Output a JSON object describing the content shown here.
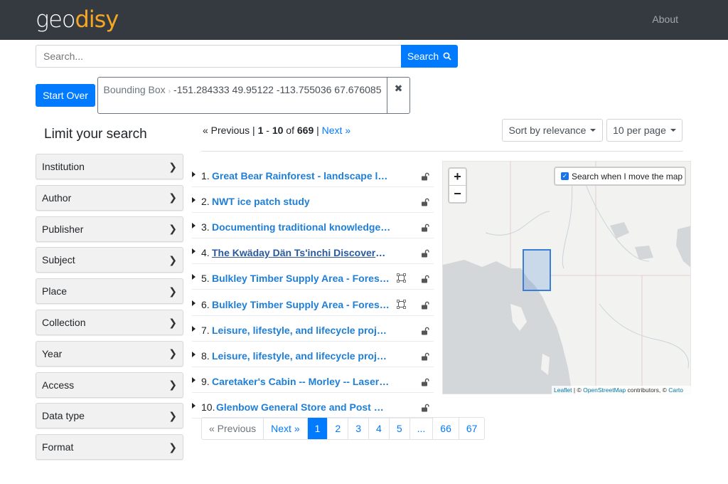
{
  "nav": {
    "logo_geo": "geo",
    "logo_disy": "disy",
    "about": "About"
  },
  "search": {
    "placeholder": "Search...",
    "button": "Search",
    "icon": "search-icon"
  },
  "constraints": {
    "start_over": "Start Over",
    "filter_name": "Bounding Box",
    "separator": "›",
    "filter_value": "-151.284333 49.95122 -113.755036 67.676085",
    "remove": "✖"
  },
  "sidebar": {
    "title": "Limit your search",
    "facets": [
      "Institution",
      "Author",
      "Publisher",
      "Subject",
      "Place",
      "Collection",
      "Year",
      "Access",
      "Data type",
      "Format"
    ]
  },
  "paging": {
    "previous": "« Previous",
    "separator": "|",
    "start": "1",
    "dash": "-",
    "end": "10",
    "of": "of",
    "total": "669",
    "next": "Next »"
  },
  "sort": {
    "sort_label": "Sort by relevance",
    "per_page_label": "10 per page"
  },
  "results": [
    {
      "num": "1.",
      "title": "Great Bear Rainforest - landscape level...",
      "bbox_icon": false,
      "underline": false
    },
    {
      "num": "2.",
      "title": "NWT ice patch study",
      "bbox_icon": false,
      "underline": false
    },
    {
      "num": "3.",
      "title": "Documenting traditional knowledge in ...",
      "bbox_icon": false,
      "underline": false
    },
    {
      "num": "4.",
      "title": "The Kwäday Dän Ts'inchi Discovery: Ex...",
      "bbox_icon": false,
      "underline": true
    },
    {
      "num": "5.",
      "title": "Bulkley Timber Supply Area - Forest Pl...",
      "bbox_icon": true,
      "underline": false
    },
    {
      "num": "6.",
      "title": "Bulkley Timber Supply Area - Forest Pl...",
      "bbox_icon": true,
      "underline": false
    },
    {
      "num": "7.",
      "title": "Leisure, lifestyle, and lifecycle project (...",
      "bbox_icon": false,
      "underline": false
    },
    {
      "num": "8.",
      "title": "Leisure, lifestyle, and lifecycle project ...",
      "bbox_icon": false,
      "underline": false
    },
    {
      "num": "9.",
      "title": "Caretaker's Cabin -- Morley -- Laser S...",
      "bbox_icon": false,
      "underline": false
    },
    {
      "num": "10.",
      "title": "Glenbow General Store and Post Offic...",
      "bbox_icon": false,
      "underline": false
    }
  ],
  "map": {
    "zoom_in": "+",
    "zoom_out": "−",
    "search_when_move": "Search when I move the map",
    "search_checked": true,
    "attribution_leaflet": "Leaflet",
    "attribution_mid": " | © ",
    "attribution_osm": "OpenStreetMap",
    "attribution_contrib": " contributors, © ",
    "attribution_carto": "Carto",
    "land_color": "#f2f2f0",
    "water_color": "#d4d7da",
    "bbox_color": "#3a7fd5"
  },
  "pager": [
    "« Previous",
    "Next »",
    "1",
    "2",
    "3",
    "4",
    "5",
    "...",
    "66",
    "67"
  ]
}
